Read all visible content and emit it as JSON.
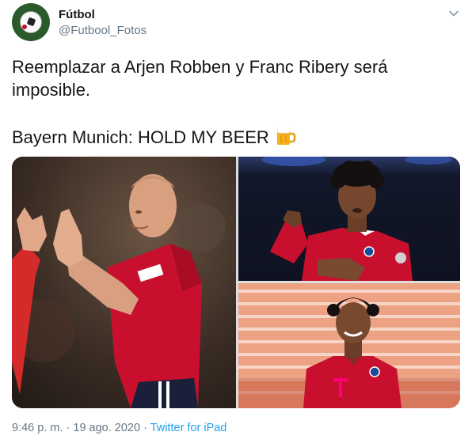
{
  "author": {
    "name": "Fútbol",
    "handle": "@Futbool_Fotos",
    "avatar_icon": "soccer-ball-avatar"
  },
  "menu_icon": "chevron-down-icon",
  "tweet": {
    "line1": "Reemplazar a Arjen Robben y Franc Ribery será imposible.",
    "line2": "Bayern Munich: HOLD MY BEER",
    "emoji": "beer-mug-icon"
  },
  "media": {
    "count": 3,
    "photo_icons": [
      "player-photo-1",
      "player-photo-2",
      "player-photo-3"
    ]
  },
  "footer": {
    "time": "9:46 p. m.",
    "separator": " · ",
    "date": "19 ago. 2020",
    "source": "Twitter for iPad"
  },
  "colors": {
    "link": "#1da1f2",
    "secondary_text": "#657786",
    "primary_text": "#14171a",
    "bayern_red": "#c8102e"
  }
}
